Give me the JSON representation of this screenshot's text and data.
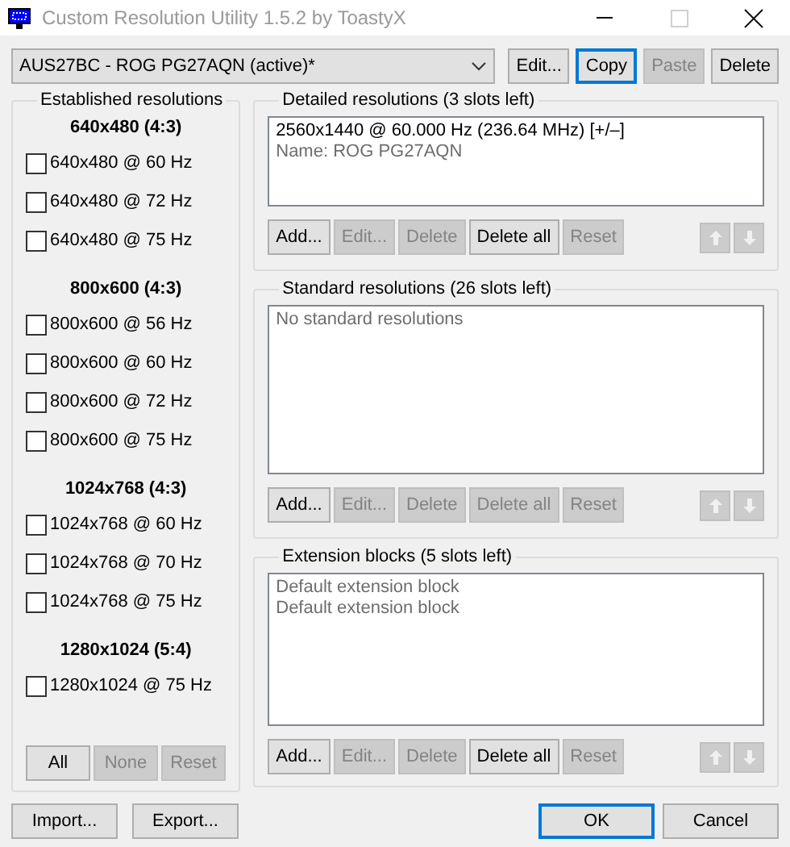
{
  "window": {
    "title": "Custom Resolution Utility 1.5.2 by ToastyX",
    "controls": [
      {
        "kind": "minimize",
        "disabled": false
      },
      {
        "kind": "maximize",
        "disabled": true
      },
      {
        "kind": "close",
        "disabled": false
      }
    ]
  },
  "device_select": {
    "value": "AUS27BC - ROG PG27AQN (active)*"
  },
  "top_buttons": [
    {
      "label": "Edit...",
      "disabled": false,
      "focused": false
    },
    {
      "label": "Copy",
      "disabled": false,
      "focused": true
    },
    {
      "label": "Paste",
      "disabled": true,
      "focused": false
    },
    {
      "label": "Delete",
      "disabled": false,
      "focused": false
    }
  ],
  "established": {
    "title": "Established resolutions",
    "groups": [
      {
        "heading": "640x480 (4:3)",
        "items": [
          {
            "label": "640x480 @ 60 Hz",
            "checked": false
          },
          {
            "label": "640x480 @ 72 Hz",
            "checked": false
          },
          {
            "label": "640x480 @ 75 Hz",
            "checked": false
          }
        ]
      },
      {
        "heading": "800x600 (4:3)",
        "items": [
          {
            "label": "800x600 @ 56 Hz",
            "checked": false
          },
          {
            "label": "800x600 @ 60 Hz",
            "checked": false
          },
          {
            "label": "800x600 @ 72 Hz",
            "checked": false
          },
          {
            "label": "800x600 @ 75 Hz",
            "checked": false
          }
        ]
      },
      {
        "heading": "1024x768 (4:3)",
        "items": [
          {
            "label": "1024x768 @ 60 Hz",
            "checked": false
          },
          {
            "label": "1024x768 @ 70 Hz",
            "checked": false
          },
          {
            "label": "1024x768 @ 75 Hz",
            "checked": false
          }
        ]
      },
      {
        "heading": "1280x1024 (5:4)",
        "items": [
          {
            "label": "1280x1024 @ 75 Hz",
            "checked": false
          }
        ]
      }
    ],
    "buttons": [
      {
        "label": "All",
        "disabled": false
      },
      {
        "label": "None",
        "disabled": true
      },
      {
        "label": "Reset",
        "disabled": true
      }
    ]
  },
  "sections": [
    {
      "title": "Detailed resolutions (3 slots left)",
      "lines": [
        {
          "text": "2560x1440 @ 60.000 Hz (236.64 MHz) [+/–]",
          "dimmed": false
        },
        {
          "text": "Name: ROG PG27AQN",
          "dimmed": true
        }
      ],
      "buttons": [
        {
          "label": "Add...",
          "disabled": false
        },
        {
          "label": "Edit...",
          "disabled": true
        },
        {
          "label": "Delete",
          "disabled": true
        },
        {
          "label": "Delete all",
          "disabled": false
        },
        {
          "label": "Reset",
          "disabled": true
        }
      ],
      "arrows": [
        {
          "kind": "up",
          "disabled": true
        },
        {
          "kind": "down",
          "disabled": true
        }
      ]
    },
    {
      "title": "Standard resolutions (26 slots left)",
      "lines": [
        {
          "text": "No standard resolutions",
          "dimmed": true
        }
      ],
      "buttons": [
        {
          "label": "Add...",
          "disabled": false
        },
        {
          "label": "Edit...",
          "disabled": true
        },
        {
          "label": "Delete",
          "disabled": true
        },
        {
          "label": "Delete all",
          "disabled": true
        },
        {
          "label": "Reset",
          "disabled": true
        }
      ],
      "arrows": [
        {
          "kind": "up",
          "disabled": true
        },
        {
          "kind": "down",
          "disabled": true
        }
      ]
    },
    {
      "title": "Extension blocks (5 slots left)",
      "lines": [
        {
          "text": "Default extension block",
          "dimmed": true
        },
        {
          "text": "Default extension block",
          "dimmed": true
        }
      ],
      "buttons": [
        {
          "label": "Add...",
          "disabled": false
        },
        {
          "label": "Edit...",
          "disabled": true
        },
        {
          "label": "Delete",
          "disabled": true
        },
        {
          "label": "Delete all",
          "disabled": false
        },
        {
          "label": "Reset",
          "disabled": true
        }
      ],
      "arrows": [
        {
          "kind": "up",
          "disabled": true
        },
        {
          "kind": "down",
          "disabled": true
        }
      ]
    }
  ],
  "footer_left": [
    {
      "label": "Import...",
      "focused": false
    },
    {
      "label": "Export...",
      "focused": false
    }
  ],
  "footer_right": [
    {
      "label": "OK",
      "focused": true
    },
    {
      "label": "Cancel",
      "focused": false
    }
  ]
}
